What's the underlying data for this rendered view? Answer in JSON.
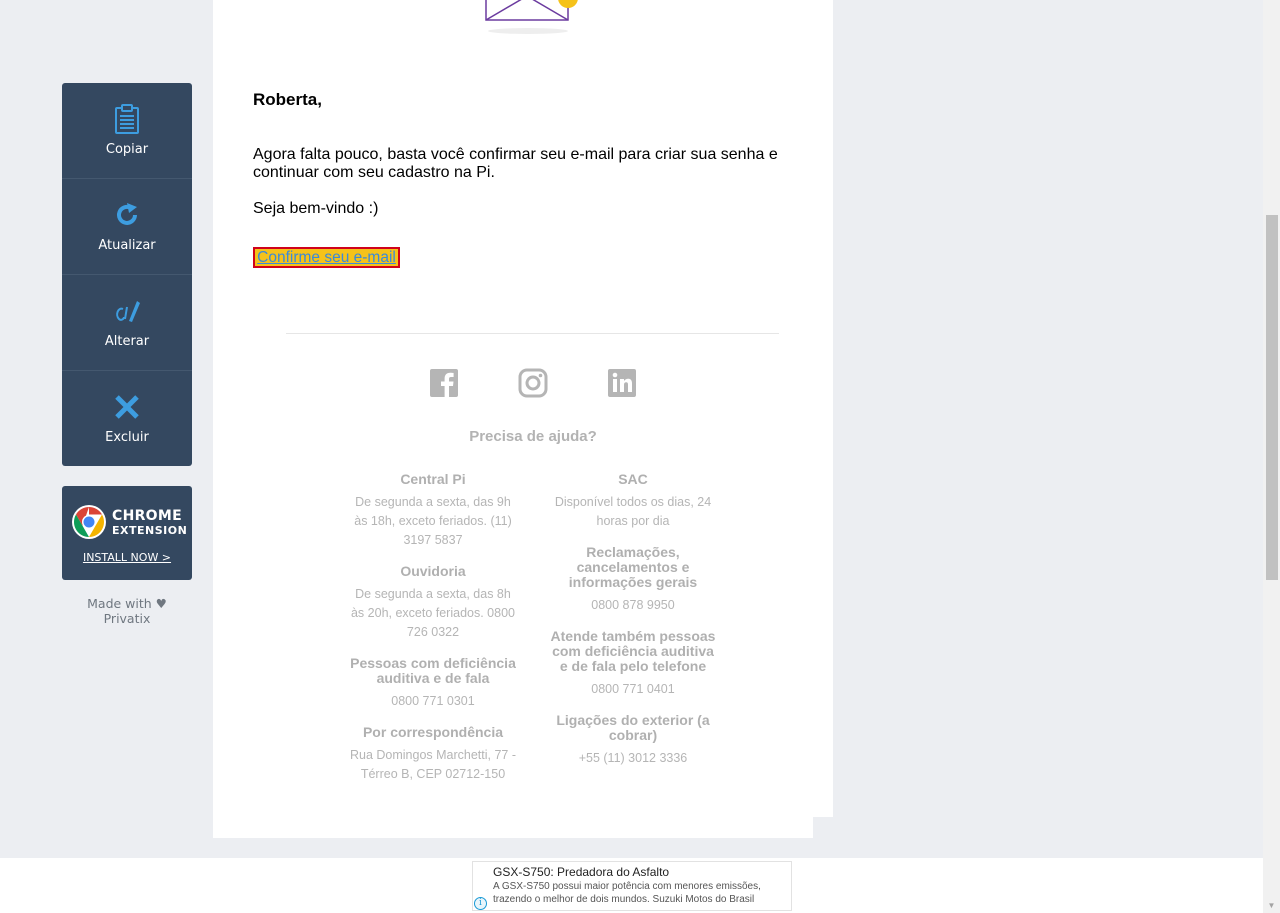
{
  "side_panel": {
    "items": [
      {
        "label": "Copiar",
        "icon": "clipboard-icon"
      },
      {
        "label": "Atualizar",
        "icon": "refresh-icon"
      },
      {
        "label": "Alterar",
        "icon": "edit-icon"
      },
      {
        "label": "Excluir",
        "icon": "close-icon"
      }
    ],
    "chrome_extension": {
      "title": "CHROME",
      "subtitle": "EXTENSION",
      "install": "INSTALL NOW >"
    },
    "made_with": "Made with ♥ Privatix"
  },
  "email": {
    "greeting": "Roberta,",
    "paragraph1": "Agora falta pouco, basta você confirmar seu e-mail para criar sua senha e continuar com seu cadastro na Pi.",
    "paragraph2": "Seja bem-vindo :)",
    "confirm_link": "Confirme seu e-mail",
    "social": [
      "facebook-icon",
      "instagram-icon",
      "linkedin-icon"
    ],
    "help_title": "Precisa de ajuda?",
    "left_column": [
      {
        "heading": "Central Pi",
        "text": "De segunda a sexta, das 9h às 18h, exceto feriados. (11) 3197 5837"
      },
      {
        "heading": "Ouvidoria",
        "text": "De segunda a sexta, das 8h às 20h, exceto feriados. 0800 726 0322"
      },
      {
        "heading": "Pessoas com deficiência auditiva e de fala",
        "text": "0800 771 0301"
      },
      {
        "heading": "Por correspondência",
        "text": "Rua Domingos Marchetti, 77 - Térreo B, CEP 02712-150"
      }
    ],
    "right_column": [
      {
        "heading": "SAC",
        "text": "Disponível todos os dias, 24 horas por dia"
      },
      {
        "heading": "Reclamações, cancelamentos e informações gerais",
        "text": "0800 878 9950"
      },
      {
        "heading": "Atende também pessoas com deficiência auditiva e de fala pelo telefone",
        "text": "0800 771 0401"
      },
      {
        "heading": "Ligações do exterior (a cobrar)",
        "text": "+55 (11) 3012 3336"
      }
    ]
  },
  "ad": {
    "title": "GSX-S750: Predadora do Asfalto",
    "text": "A GSX-S750 possui maior potência com menores emissões, trazendo o melhor de dois mundos. Suzuki Motos do Brasil",
    "info_icon": "info-icon"
  },
  "colors": {
    "panel": "#344860",
    "accent_blue": "#3d9de0",
    "link_highlight": "#f5c21a",
    "link_border": "#d0021b",
    "footer_gray": "#b3b3b3"
  }
}
